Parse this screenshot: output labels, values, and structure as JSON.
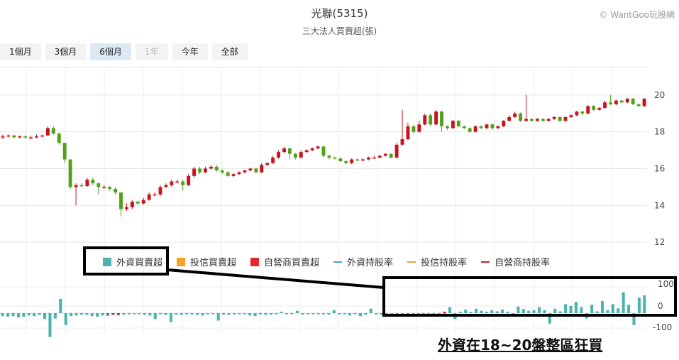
{
  "header": {
    "title": "光聯(5315)",
    "subtitle": "三大法人買賣超(張)",
    "credit": "© WantGoo玩股網"
  },
  "range_buttons": [
    {
      "label": "1個月",
      "state": "normal"
    },
    {
      "label": "3個月",
      "state": "normal"
    },
    {
      "label": "6個月",
      "state": "active"
    },
    {
      "label": "1年",
      "state": "disabled"
    },
    {
      "label": "今年",
      "state": "normal"
    },
    {
      "label": "全部",
      "state": "normal"
    }
  ],
  "legend": [
    {
      "label": "外資買賣超",
      "kind": "square",
      "color": "#4cb3ad"
    },
    {
      "label": "投信買賣超",
      "kind": "square",
      "color": "#f4a223"
    },
    {
      "label": "自營商買賣超",
      "kind": "square",
      "color": "#e8262a"
    },
    {
      "label": "外資持股率",
      "kind": "line",
      "color": "#4aa8c4"
    },
    {
      "label": "投信持股率",
      "kind": "line",
      "color": "#e0a03a"
    },
    {
      "label": "自營商持股率",
      "kind": "line",
      "color": "#c8202a"
    }
  ],
  "annotation": "外資在18~20盤整區狂買",
  "chart_data": [
    {
      "type": "candlestick",
      "title": "光聯(5315)",
      "ylim": [
        11.5,
        21.5
      ],
      "yticks": [
        "12",
        "14",
        "16",
        "18",
        "20"
      ],
      "up_color": "#c8141e",
      "down_color": "#52a219",
      "bars": [
        [
          17.7,
          17.75,
          17.85,
          17.6
        ],
        [
          17.75,
          17.8,
          17.85,
          17.7
        ],
        [
          17.8,
          17.7,
          17.85,
          17.65
        ],
        [
          17.7,
          17.75,
          17.8,
          17.65
        ],
        [
          17.75,
          17.7,
          17.8,
          17.6
        ],
        [
          17.7,
          17.7,
          17.8,
          17.6
        ],
        [
          17.7,
          17.75,
          17.85,
          17.65
        ],
        [
          17.75,
          17.8,
          17.85,
          17.7
        ],
        [
          17.8,
          18.2,
          18.3,
          17.8
        ],
        [
          18.2,
          17.9,
          18.3,
          17.85
        ],
        [
          17.9,
          17.4,
          17.95,
          17.3
        ],
        [
          17.4,
          16.5,
          17.4,
          16.3
        ],
        [
          16.5,
          15.0,
          16.5,
          14.9
        ],
        [
          15.0,
          15.1,
          15.2,
          14.0
        ],
        [
          15.1,
          15.05,
          15.2,
          15.0
        ],
        [
          15.05,
          15.4,
          15.5,
          15.0
        ],
        [
          15.4,
          15.2,
          15.5,
          15.1
        ],
        [
          15.2,
          15.0,
          15.25,
          14.6
        ],
        [
          15.0,
          15.0,
          15.1,
          14.9
        ],
        [
          15.0,
          14.9,
          15.05,
          14.8
        ],
        [
          14.9,
          14.7,
          15.0,
          14.6
        ],
        [
          14.7,
          13.8,
          14.7,
          13.4
        ],
        [
          13.8,
          13.9,
          14.1,
          13.7
        ],
        [
          13.9,
          14.2,
          14.3,
          13.8
        ],
        [
          14.2,
          14.1,
          14.25,
          14.05
        ],
        [
          14.1,
          14.3,
          14.4,
          14.05
        ],
        [
          14.3,
          14.6,
          14.7,
          14.25
        ],
        [
          14.6,
          14.6,
          14.7,
          14.5
        ],
        [
          14.6,
          15.0,
          15.1,
          14.5
        ],
        [
          15.0,
          15.1,
          15.2,
          14.95
        ],
        [
          15.1,
          15.3,
          15.4,
          15.0
        ],
        [
          15.3,
          15.3,
          15.4,
          15.2
        ],
        [
          15.3,
          15.1,
          15.4,
          14.8
        ],
        [
          15.1,
          15.6,
          15.7,
          15.05
        ],
        [
          15.6,
          16.0,
          16.1,
          15.5
        ],
        [
          16.0,
          15.8,
          16.1,
          15.7
        ],
        [
          15.8,
          16.0,
          16.1,
          15.75
        ],
        [
          16.0,
          16.1,
          16.2,
          15.95
        ],
        [
          16.1,
          15.9,
          16.2,
          15.85
        ],
        [
          15.9,
          15.8,
          15.95,
          15.7
        ],
        [
          15.8,
          15.6,
          15.85,
          15.55
        ],
        [
          15.6,
          15.7,
          15.75,
          15.55
        ],
        [
          15.7,
          15.8,
          15.85,
          15.65
        ],
        [
          15.8,
          15.9,
          15.95,
          15.75
        ],
        [
          15.9,
          16.0,
          16.05,
          15.85
        ],
        [
          16.0,
          15.8,
          16.05,
          15.75
        ],
        [
          15.8,
          16.2,
          16.3,
          15.75
        ],
        [
          16.2,
          16.3,
          16.35,
          16.15
        ],
        [
          16.3,
          16.6,
          16.7,
          16.25
        ],
        [
          16.6,
          16.9,
          17.0,
          16.55
        ],
        [
          16.9,
          17.1,
          17.2,
          16.85
        ],
        [
          17.1,
          16.8,
          17.15,
          16.5
        ],
        [
          16.8,
          16.6,
          16.85,
          16.5
        ],
        [
          16.6,
          16.9,
          17.0,
          16.55
        ],
        [
          16.9,
          17.0,
          17.05,
          16.85
        ],
        [
          17.0,
          17.1,
          17.15,
          16.95
        ],
        [
          17.1,
          17.2,
          17.25,
          17.05
        ],
        [
          17.2,
          16.7,
          17.25,
          16.6
        ],
        [
          16.7,
          16.6,
          16.75,
          16.5
        ],
        [
          16.6,
          16.55,
          16.65,
          16.5
        ],
        [
          16.55,
          16.4,
          16.6,
          16.35
        ],
        [
          16.4,
          16.3,
          16.45,
          16.25
        ],
        [
          16.3,
          16.5,
          16.55,
          16.25
        ],
        [
          16.5,
          16.45,
          16.55,
          16.4
        ],
        [
          16.45,
          16.5,
          16.55,
          16.4
        ],
        [
          16.5,
          16.6,
          16.65,
          16.45
        ],
        [
          16.6,
          16.6,
          16.7,
          16.55
        ],
        [
          16.6,
          16.7,
          16.75,
          16.55
        ],
        [
          16.7,
          16.8,
          16.85,
          16.65
        ],
        [
          16.8,
          16.6,
          16.85,
          16.55
        ],
        [
          16.6,
          17.3,
          17.4,
          16.55
        ],
        [
          17.3,
          17.6,
          19.2,
          17.25
        ],
        [
          17.6,
          18.3,
          18.5,
          17.55
        ],
        [
          18.3,
          18.0,
          18.4,
          17.9
        ],
        [
          18.0,
          18.4,
          18.6,
          17.95
        ],
        [
          18.4,
          18.9,
          19.0,
          18.35
        ],
        [
          18.9,
          18.4,
          19.0,
          18.3
        ],
        [
          18.4,
          19.1,
          19.2,
          18.35
        ],
        [
          19.1,
          18.3,
          19.15,
          18.0
        ],
        [
          18.3,
          18.2,
          18.35,
          18.1
        ],
        [
          18.2,
          18.6,
          18.65,
          18.15
        ],
        [
          18.6,
          18.3,
          18.65,
          18.25
        ],
        [
          18.3,
          18.2,
          18.35,
          18.15
        ],
        [
          18.2,
          18.0,
          18.25,
          17.95
        ],
        [
          18.0,
          18.3,
          18.35,
          17.95
        ],
        [
          18.3,
          18.2,
          18.35,
          18.15
        ],
        [
          18.2,
          18.4,
          18.45,
          18.15
        ],
        [
          18.4,
          18.2,
          18.45,
          18.1
        ],
        [
          18.2,
          18.3,
          18.35,
          18.15
        ],
        [
          18.3,
          18.6,
          18.65,
          18.25
        ],
        [
          18.6,
          18.8,
          18.9,
          18.55
        ],
        [
          18.8,
          19.0,
          19.1,
          18.75
        ],
        [
          19.0,
          18.6,
          19.05,
          18.55
        ],
        [
          18.6,
          18.7,
          20.0,
          18.55
        ],
        [
          18.7,
          18.6,
          18.75,
          18.55
        ],
        [
          18.6,
          18.7,
          18.75,
          18.55
        ],
        [
          18.7,
          18.6,
          18.75,
          18.55
        ],
        [
          18.6,
          18.7,
          18.75,
          18.55
        ],
        [
          18.7,
          18.8,
          18.85,
          18.65
        ],
        [
          18.8,
          18.6,
          18.85,
          18.55
        ],
        [
          18.6,
          18.8,
          18.85,
          18.55
        ],
        [
          18.8,
          18.9,
          18.95,
          18.75
        ],
        [
          18.9,
          19.1,
          19.15,
          18.85
        ],
        [
          19.1,
          19.0,
          19.15,
          18.9
        ],
        [
          19.0,
          19.4,
          19.45,
          18.95
        ],
        [
          19.4,
          19.2,
          19.45,
          19.15
        ],
        [
          19.2,
          19.3,
          19.35,
          19.15
        ],
        [
          19.3,
          19.6,
          19.7,
          19.25
        ],
        [
          19.6,
          19.5,
          20.0,
          19.45
        ],
        [
          19.5,
          19.7,
          19.75,
          19.45
        ],
        [
          19.7,
          19.6,
          19.75,
          19.55
        ],
        [
          19.6,
          19.8,
          19.85,
          19.55
        ],
        [
          19.8,
          19.5,
          19.85,
          19.45
        ],
        [
          19.5,
          19.4,
          19.55,
          19.35
        ],
        [
          19.4,
          19.8,
          19.85,
          19.35
        ]
      ]
    },
    {
      "type": "bar",
      "title": "三大法人買賣超(張)",
      "ylim": [
        -100,
        100
      ],
      "yticks": [
        "100",
        "0",
        "-100"
      ],
      "series": [
        {
          "name": "外資買賣超",
          "color": "#4cb3ad",
          "values": [
            -10,
            -12,
            -10,
            -14,
            -12,
            -8,
            -10,
            -6,
            -20,
            -80,
            -18,
            48,
            -40,
            -10,
            -8,
            -5,
            -6,
            -10,
            -12,
            -8,
            -10,
            -6,
            -8,
            -5,
            -4,
            -3,
            -2,
            -5,
            -8,
            -20,
            -3,
            -6,
            -30,
            -5,
            -6,
            -2,
            -4,
            -6,
            -8,
            -4,
            -3,
            -25,
            -5,
            -6,
            -4,
            -3,
            -2,
            -8,
            -10,
            -4,
            -6,
            -5,
            -3,
            5,
            -4,
            -2,
            8,
            -5,
            -2,
            -4,
            -3,
            -2,
            -5,
            10,
            -4,
            -3,
            -8,
            -2,
            -10,
            -5,
            15,
            -4,
            -6,
            -5,
            -3,
            -2,
            -4,
            -6,
            -8,
            -10,
            -4,
            -3,
            -6,
            -5,
            -8,
            20,
            -20,
            5,
            12,
            4,
            15,
            8,
            5,
            10,
            6,
            12,
            5,
            -8,
            22,
            14,
            8,
            10,
            20,
            10,
            -35,
            15,
            6,
            30,
            24,
            38,
            20,
            -18,
            28,
            6,
            40,
            10,
            30,
            16,
            70,
            28,
            -40,
            52,
            60
          ]
        },
        {
          "name": "自營商買賣超",
          "color": "#e8262a",
          "values": [
            0,
            0,
            0,
            0,
            0,
            0,
            0,
            0,
            0,
            0,
            0,
            0,
            0,
            0,
            0,
            0,
            0,
            0,
            0,
            0,
            -3,
            -5,
            -4,
            0,
            0,
            0,
            0,
            0,
            0,
            0,
            0,
            0,
            0,
            0,
            0,
            0,
            0,
            0,
            0,
            0,
            0,
            0,
            0,
            0,
            0,
            0,
            0,
            0,
            0,
            0,
            0,
            0,
            0,
            0,
            0,
            0,
            0,
            0,
            0,
            0,
            0,
            0,
            0,
            0,
            0,
            0,
            0,
            0,
            0,
            0,
            0,
            0,
            0,
            0,
            0,
            0,
            0,
            0,
            0,
            0,
            0,
            0,
            0,
            0,
            5,
            0,
            0,
            0,
            0,
            0,
            0,
            0,
            0,
            0,
            0,
            0,
            0,
            0,
            0,
            0,
            0,
            0,
            0,
            0,
            0,
            0,
            0,
            0,
            0,
            0,
            0,
            0,
            0,
            0,
            0,
            0,
            0,
            0,
            0,
            0,
            0,
            0
          ]
        }
      ]
    }
  ]
}
